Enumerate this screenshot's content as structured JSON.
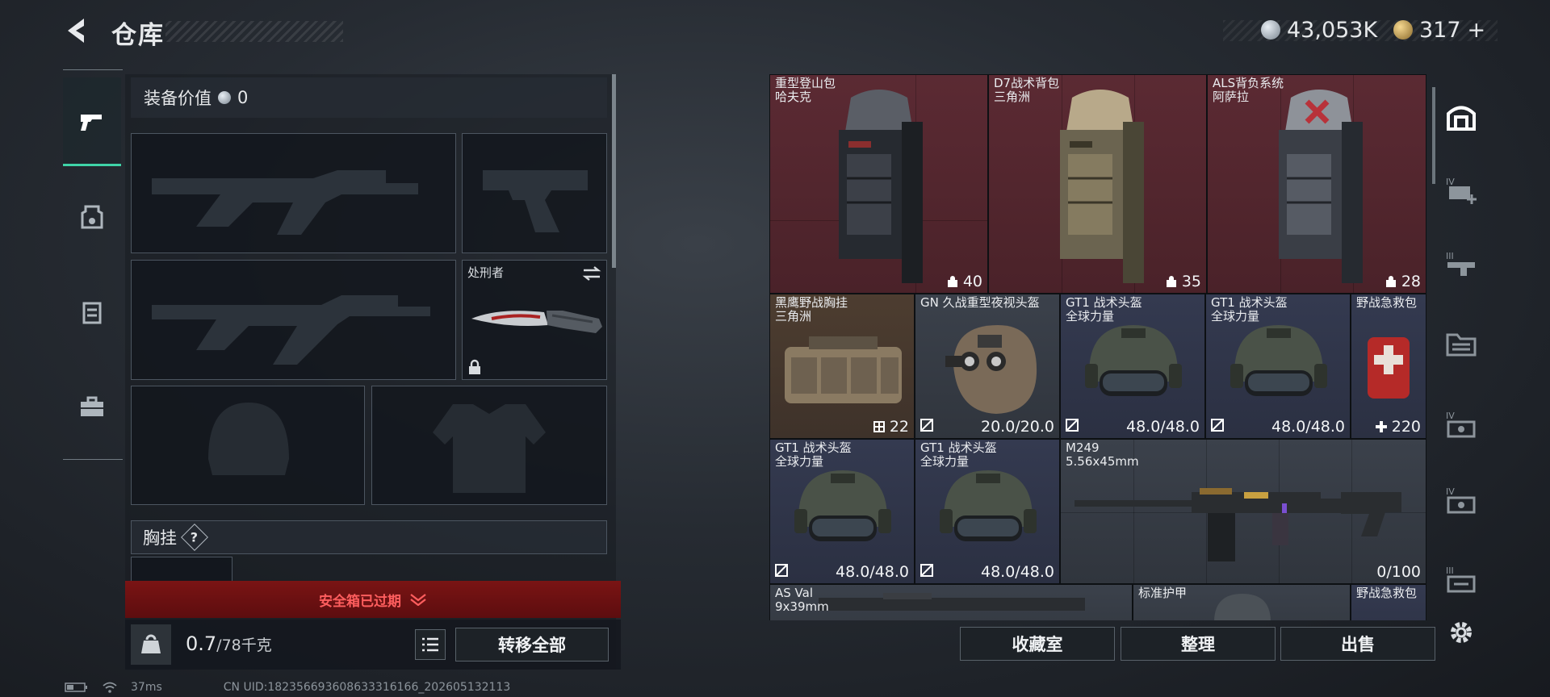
{
  "header": {
    "title": "仓库",
    "currency_silver": "43,053K",
    "currency_gold": "317",
    "plus": "+"
  },
  "left_tabs": [
    {
      "id": "weapons",
      "icon": "pistol-icon",
      "active": true
    },
    {
      "id": "armor",
      "icon": "armor-icon",
      "active": false
    },
    {
      "id": "rig",
      "icon": "chest-rig-icon",
      "active": false
    },
    {
      "id": "case",
      "icon": "briefcase-icon",
      "active": false
    }
  ],
  "loadout": {
    "value_label": "装备价值",
    "value": "0",
    "melee_name": "处刑者",
    "rig_section": "胸挂",
    "help": "?",
    "expired_label": "安全箱已过期",
    "weight_value": "0.7",
    "weight_capacity": "/78千克",
    "transfer_all": "转移全部"
  },
  "stash_items": [
    {
      "name": "重型登山包",
      "sub": "哈夫克",
      "stat": "40",
      "bg": "red"
    },
    {
      "name": "D7战术背包",
      "sub": "三角洲",
      "stat": "35",
      "bg": "red"
    },
    {
      "name": "ALS背负系统",
      "sub": "阿萨拉",
      "stat": "28",
      "bg": "red"
    },
    {
      "name": "黑鹰野战胸挂",
      "sub": "三角洲",
      "stat": "22",
      "bg": "brown"
    },
    {
      "name": "GN 久战重型夜视头盔",
      "sub": "",
      "stat": "20.0/20.0",
      "bg": "grey"
    },
    {
      "name": "GT1 战术头盔",
      "sub": "全球力量",
      "stat": "48.0/48.0",
      "bg": "blue"
    },
    {
      "name": "GT1 战术头盔",
      "sub": "全球力量",
      "stat": "48.0/48.0",
      "bg": "blue"
    },
    {
      "name": "野战急救包",
      "sub": "",
      "stat": "220",
      "bg": "blue"
    },
    {
      "name": "GT1 战术头盔",
      "sub": "全球力量",
      "stat": "48.0/48.0",
      "bg": "blue"
    },
    {
      "name": "GT1 战术头盔",
      "sub": "全球力量",
      "stat": "48.0/48.0",
      "bg": "blue"
    },
    {
      "name": "M249",
      "sub": "5.56x45mm",
      "stat": "0/100",
      "bg": "grey"
    },
    {
      "name": "AS Val",
      "sub": "9x39mm",
      "stat": "",
      "bg": "grey"
    },
    {
      "name": "标准护甲",
      "sub": "",
      "stat": "",
      "bg": "grey"
    },
    {
      "name": "野战急救包",
      "sub": "",
      "stat": "",
      "bg": "blue"
    }
  ],
  "actions": {
    "collection": "收藏室",
    "organize": "整理",
    "sell": "出售"
  },
  "right_tabs": [
    "stash-home-icon",
    "tier4-add-icon",
    "tier3-rifle-icon",
    "folder-stash-icon",
    "tier4-case-icon",
    "tier4-case-2-icon",
    "tier3-case-icon",
    "settings-gear-icon"
  ],
  "status_bar": {
    "ping": "37ms",
    "uid": "CN UID:18235669360863331616​6_202605132113"
  },
  "colors": {
    "accent": "#3fd4a8",
    "alert": "#ff5e5e"
  }
}
